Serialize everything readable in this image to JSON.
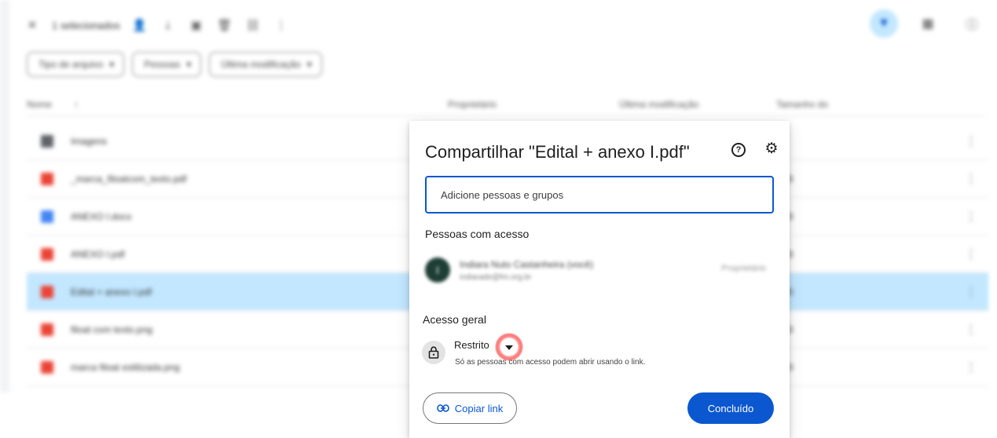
{
  "drive": {
    "selection_text": "1 selecionados",
    "toolbar_icons": [
      "close-icon",
      "share-icon",
      "download-icon",
      "move-icon",
      "trash-icon",
      "link-icon",
      "more-icon"
    ],
    "header_icons": [
      "filter-icon",
      "grid-view-icon",
      "info-icon"
    ],
    "filters": [
      "Tipo de arquivo",
      "Pessoas",
      "Última modificação"
    ],
    "columns": {
      "name": "Nome",
      "owner": "Proprietário",
      "modified": "Última modificação",
      "size": "Tamanho do"
    },
    "files": [
      {
        "name": "Imagens",
        "color": "#5f6368",
        "selected": false,
        "size": ""
      },
      {
        "name": "_marca_filoatcom_texto.pdf",
        "color": "#ea4335",
        "selected": false,
        "size": "KB"
      },
      {
        "name": "ANEXO I.docx",
        "color": "#4285f4",
        "selected": false,
        "size": "KB"
      },
      {
        "name": "ANEXO I.pdf",
        "color": "#ea4335",
        "selected": false,
        "size": "KB"
      },
      {
        "name": "Edital + anexo I.pdf",
        "color": "#ea4335",
        "selected": true,
        "size": "KB"
      },
      {
        "name": "filoat com texto.png",
        "color": "#ea4335",
        "selected": false,
        "size": "KB"
      },
      {
        "name": "marca filoat estilizada.png",
        "color": "#ea4335",
        "selected": false,
        "size": "KB"
      }
    ],
    "accent": "#c2e7ff"
  },
  "dialog": {
    "title": "Compartilhar \"Edital + anexo I.pdf\"",
    "add_placeholder": "Adicione pessoas e grupos",
    "people_title": "Pessoas com acesso",
    "person": {
      "name": "Indiara Nuto Castanheira (você)",
      "email": "indiarade@fm.org.br",
      "role": "Proprietário",
      "initial": "I"
    },
    "general_access_title": "Acesso geral",
    "access_level": "Restrito",
    "access_description": "Só as pessoas com acesso podem abrir usando o link.",
    "copy_link": "Copiar link",
    "done": "Concluído",
    "primary_color": "#0b57d0"
  }
}
